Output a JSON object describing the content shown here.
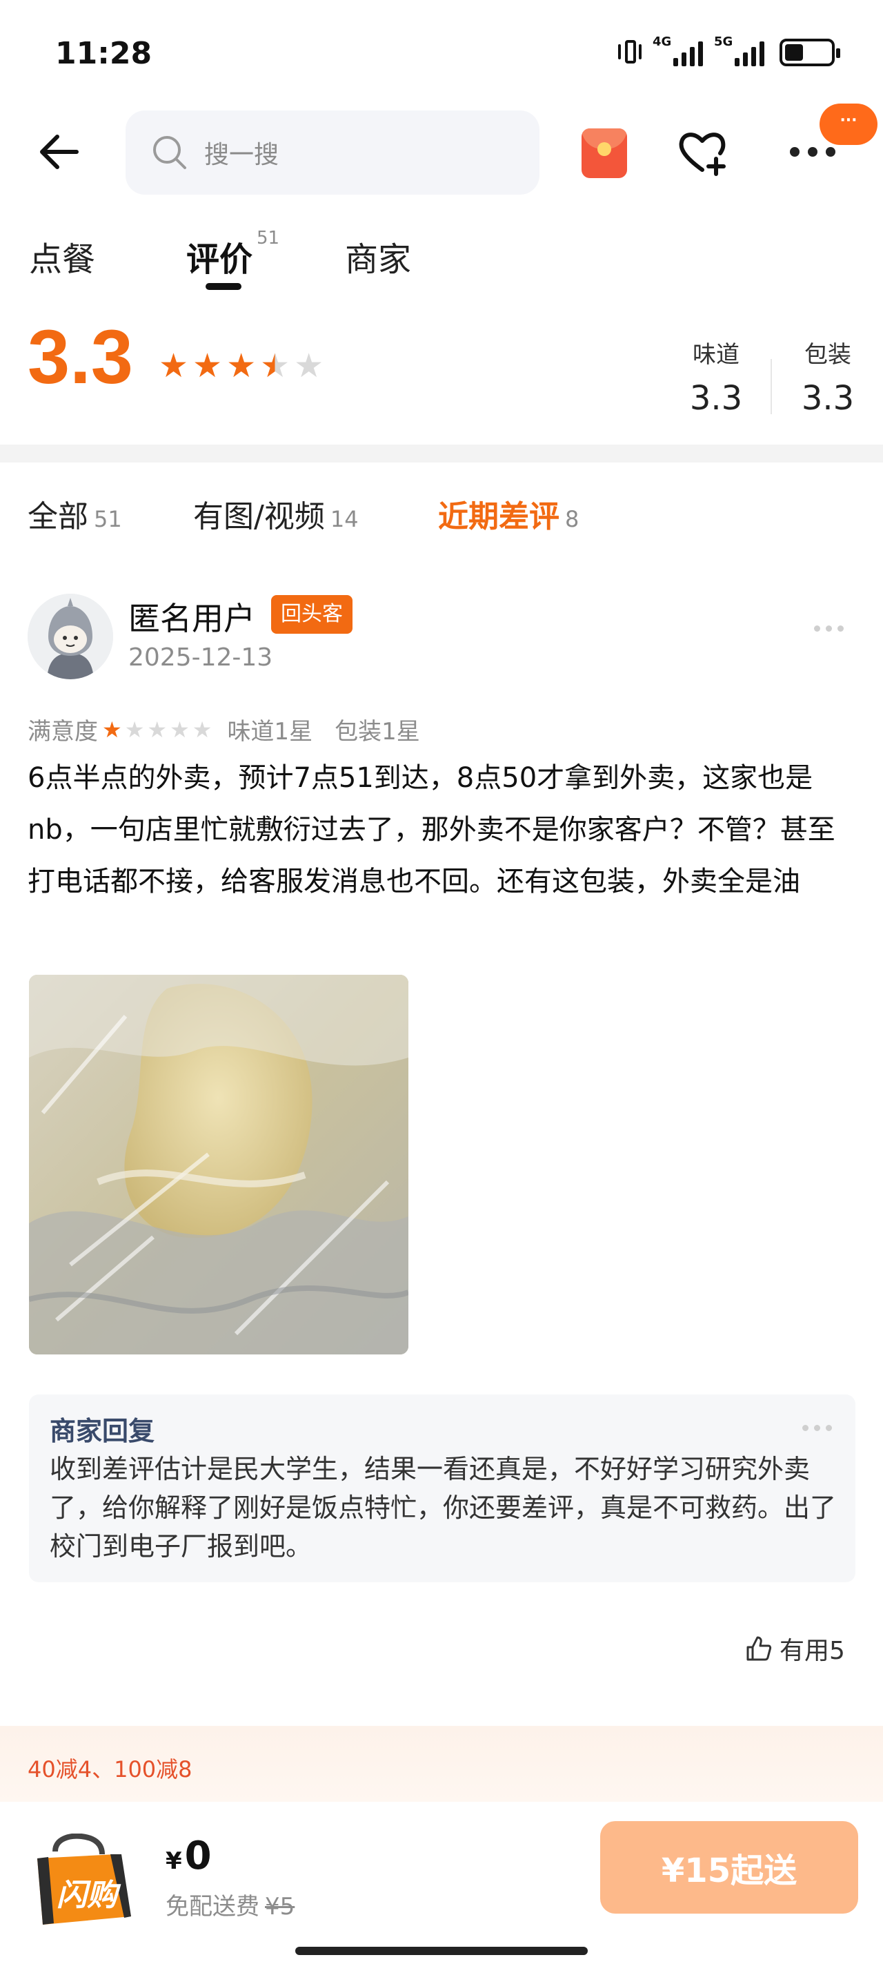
{
  "status_bar": {
    "time": "11:28",
    "net1": "4G",
    "net2": "5G"
  },
  "header": {
    "search_placeholder": "搜一搜",
    "more_badge": "···"
  },
  "tabs": [
    {
      "label": "点餐"
    },
    {
      "label": "评价",
      "count": "51"
    },
    {
      "label": "商家"
    }
  ],
  "rating": {
    "score": "3.3",
    "stars": 3.5,
    "taste_label": "味道",
    "taste_value": "3.3",
    "pack_label": "包装",
    "pack_value": "3.3"
  },
  "filters": [
    {
      "label": "全部",
      "count": "51"
    },
    {
      "label": "有图/视频",
      "count": "14"
    },
    {
      "label": "近期差评",
      "count": "8"
    }
  ],
  "review": {
    "user": "匿名用户",
    "badge": "回头客",
    "date": "2025-12-13",
    "satisfaction_label": "满意度",
    "satisfaction_stars": 1,
    "taste": "味道1星",
    "packaging": "包装1星",
    "text": "6点半点的外卖，预计7点51到达，8点50才拿到外卖，这家也是nb，一句店里忙就敷衍过去了，那外卖不是你家客户？不管？甚至打电话都不接，给客服发消息也不回。还有这包装，外卖全是油",
    "reply_title": "商家回复",
    "reply_text": "收到差评估计是民大学生，结果一看还真是，不好好学习研究外卖了，给你解释了刚好是饭点特忙，你还要差评，真是不可救药。出了校门到电子厂报到吧。",
    "useful": "有用5"
  },
  "promo": {
    "text": "40减4、100减8"
  },
  "bottom": {
    "logo_text": "闪购",
    "currency": "¥",
    "price": "0",
    "delivery_label": "免配送费",
    "delivery_original": "¥5",
    "min_order": "¥15起送"
  },
  "colors": {
    "accent": "#f26a12",
    "reply_title": "#394a6b",
    "min_order_bg": "#fdb98a"
  }
}
